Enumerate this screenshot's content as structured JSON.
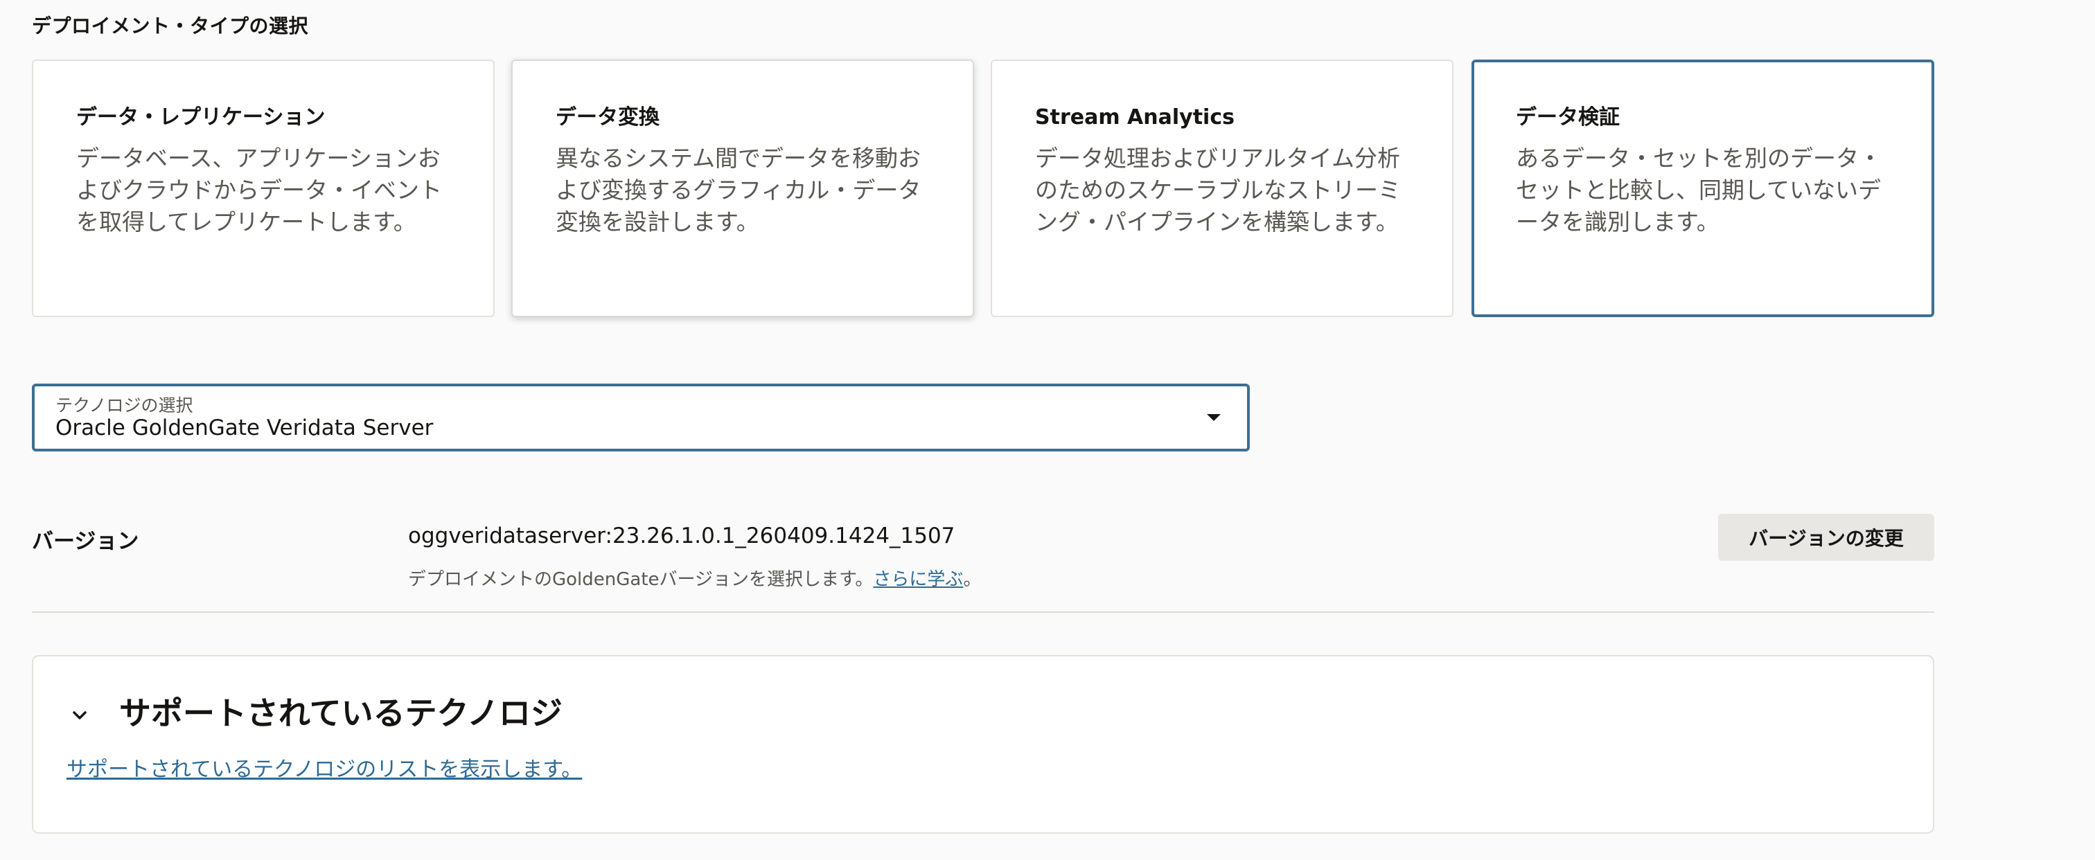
{
  "section_title": "デプロイメント・タイプの選択",
  "deployment_types": [
    {
      "title": "データ・レプリケーション",
      "description": "データベース、アプリケーションおよびクラウドからデータ・イベントを取得してレプリケートします。"
    },
    {
      "title": "データ変換",
      "description": "異なるシステム間でデータを移動および変換するグラフィカル・データ変換を設計します。"
    },
    {
      "title": "Stream Analytics",
      "description": "データ処理およびリアルタイム分析のためのスケーラブルなストリーミング・パイプラインを構築します。"
    },
    {
      "title": "データ検証",
      "description": "あるデータ・セットを別のデータ・セットと比較し、同期していないデータを識別します。",
      "selected": true
    }
  ],
  "technology_select": {
    "label": "テクノロジの選択",
    "value": "Oracle GoldenGate Veridata Server"
  },
  "version": {
    "label": "バージョン",
    "value": "oggveridataserver:23.26.1.0.1_260409.1424_1507",
    "help_prefix": "デプロイメントのGoldenGateバージョンを選択します。",
    "help_link": "さらに学ぶ",
    "help_suffix": "。",
    "change_button": "バージョンの変更"
  },
  "supported_tech": {
    "title": "サポートされているテクノロジ",
    "link": "サポートされているテクノロジのリストを表示します。"
  },
  "colors": {
    "accent": "#3e6f92",
    "link": "#2d6a95"
  }
}
